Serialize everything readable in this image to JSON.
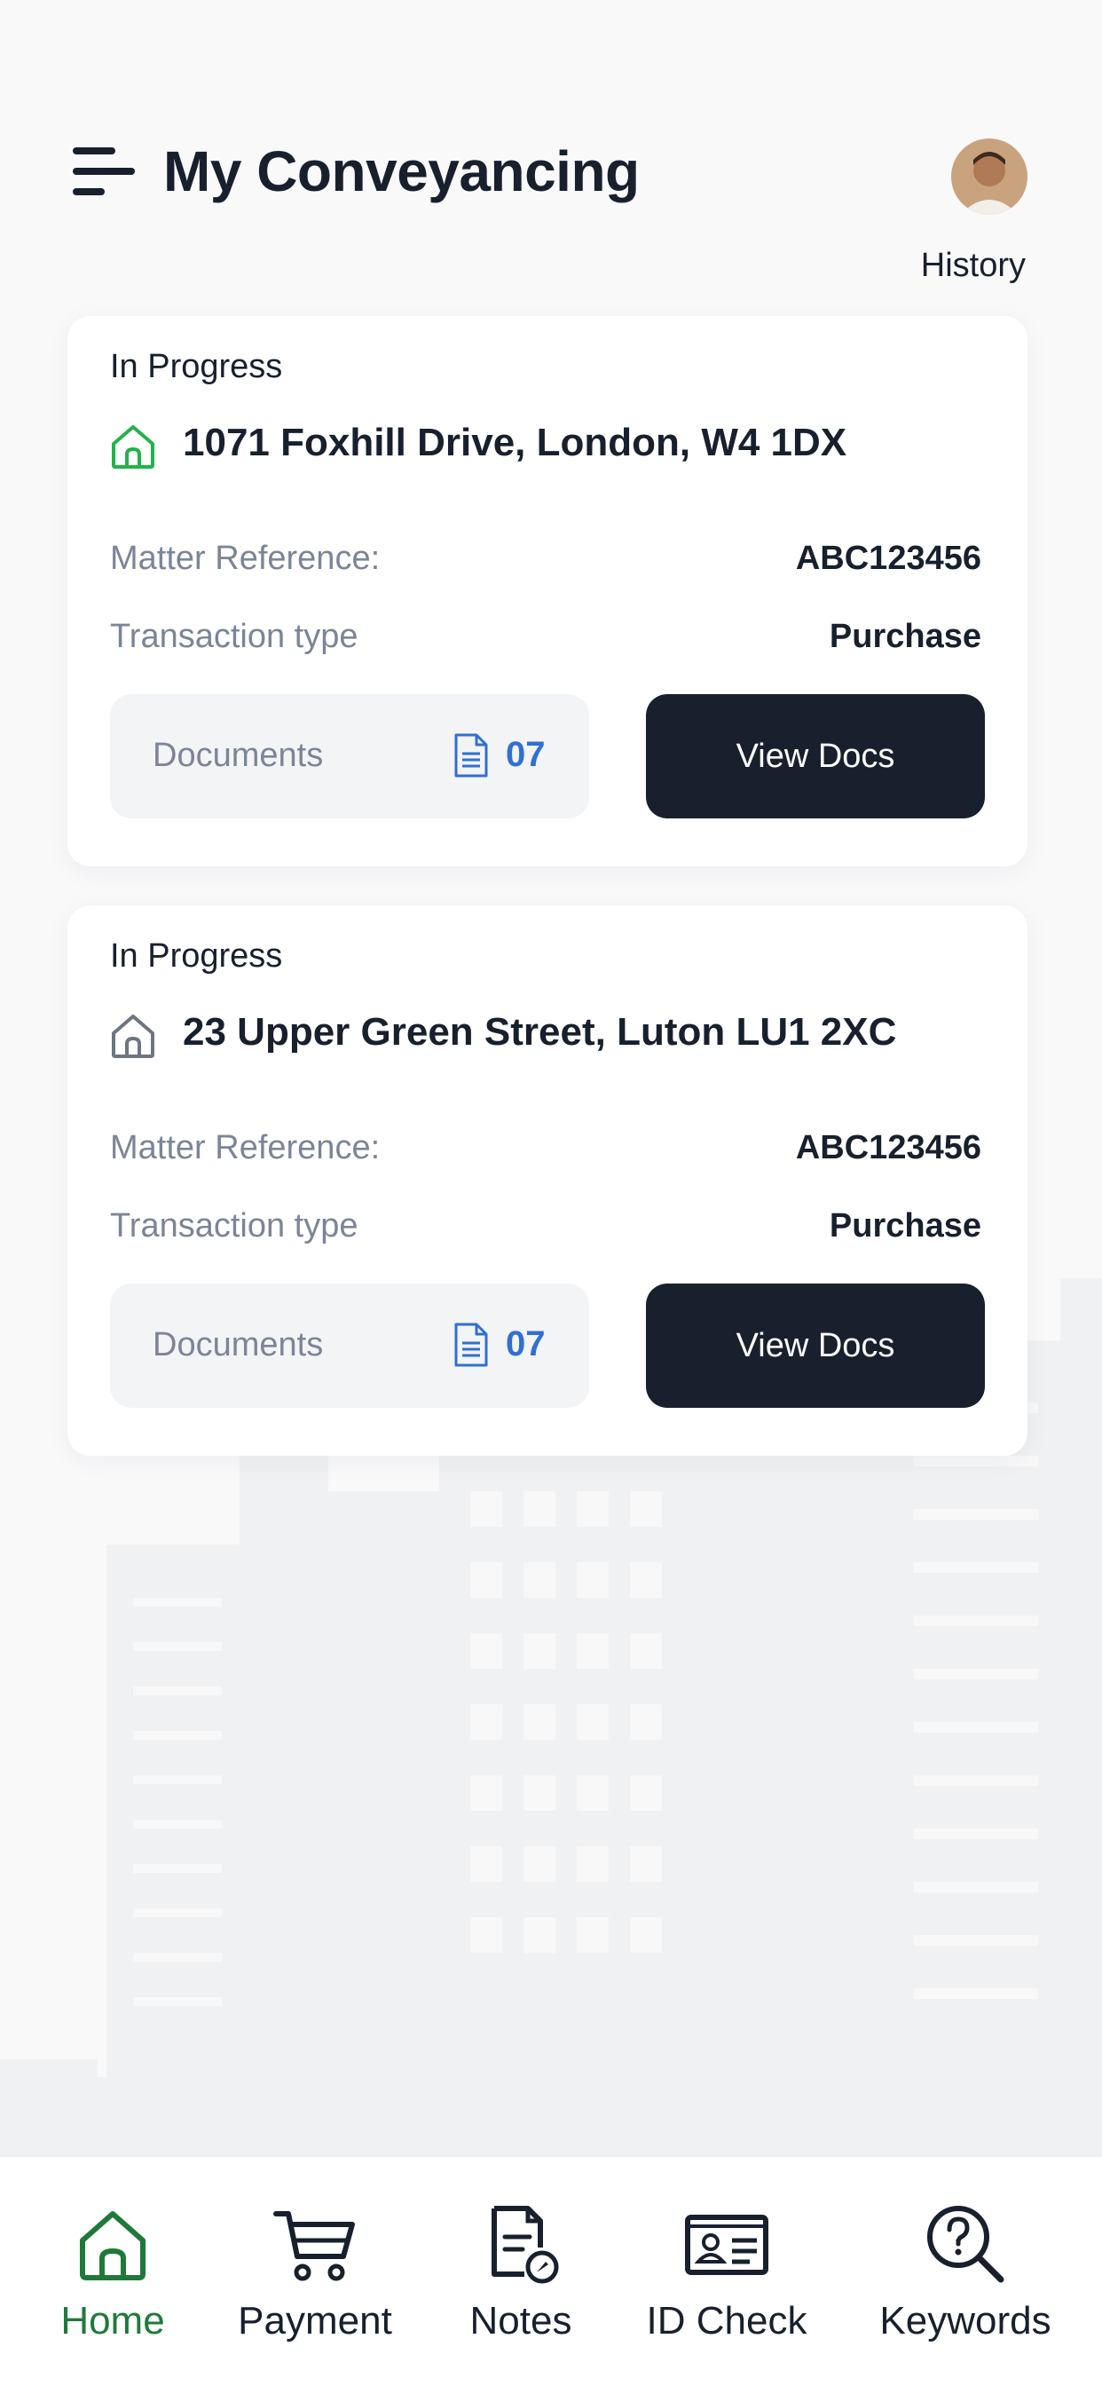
{
  "header": {
    "title": "My Conveyancing",
    "history_label": "History",
    "menu_icon": "hamburger-menu-icon",
    "avatar": "user-avatar"
  },
  "matters": [
    {
      "status": "In Progress",
      "address": "1071 Foxhill Drive, London, W4 1DX",
      "home_icon_color": "#22b24c",
      "matter_reference_label": "Matter Reference:",
      "matter_reference": "ABC123456",
      "transaction_type_label": "Transaction type",
      "transaction_type": "Purchase",
      "documents_label": "Documents",
      "documents_count": "07",
      "view_docs_label": "View Docs"
    },
    {
      "status": "In Progress",
      "address": "23 Upper Green Street, Luton LU1 2XC",
      "home_icon_color": "#6f7580",
      "matter_reference_label": "Matter Reference:",
      "matter_reference": "ABC123456",
      "transaction_type_label": "Transaction type",
      "transaction_type": "Purchase",
      "documents_label": "Documents",
      "documents_count": "07",
      "view_docs_label": "View Docs"
    }
  ],
  "tabbar": {
    "items": [
      {
        "label": "Home",
        "icon": "home-icon",
        "active": true
      },
      {
        "label": "Payment",
        "icon": "cart-icon",
        "active": false
      },
      {
        "label": "Notes",
        "icon": "notes-icon",
        "active": false
      },
      {
        "label": "ID Check",
        "icon": "id-card-icon",
        "active": false
      },
      {
        "label": "Keywords",
        "icon": "help-search-icon",
        "active": false
      }
    ]
  },
  "colors": {
    "primary_dark": "#18202e",
    "accent_green": "#1f7a3a",
    "link_blue": "#2f6fd6",
    "muted_text": "#7c8597"
  }
}
